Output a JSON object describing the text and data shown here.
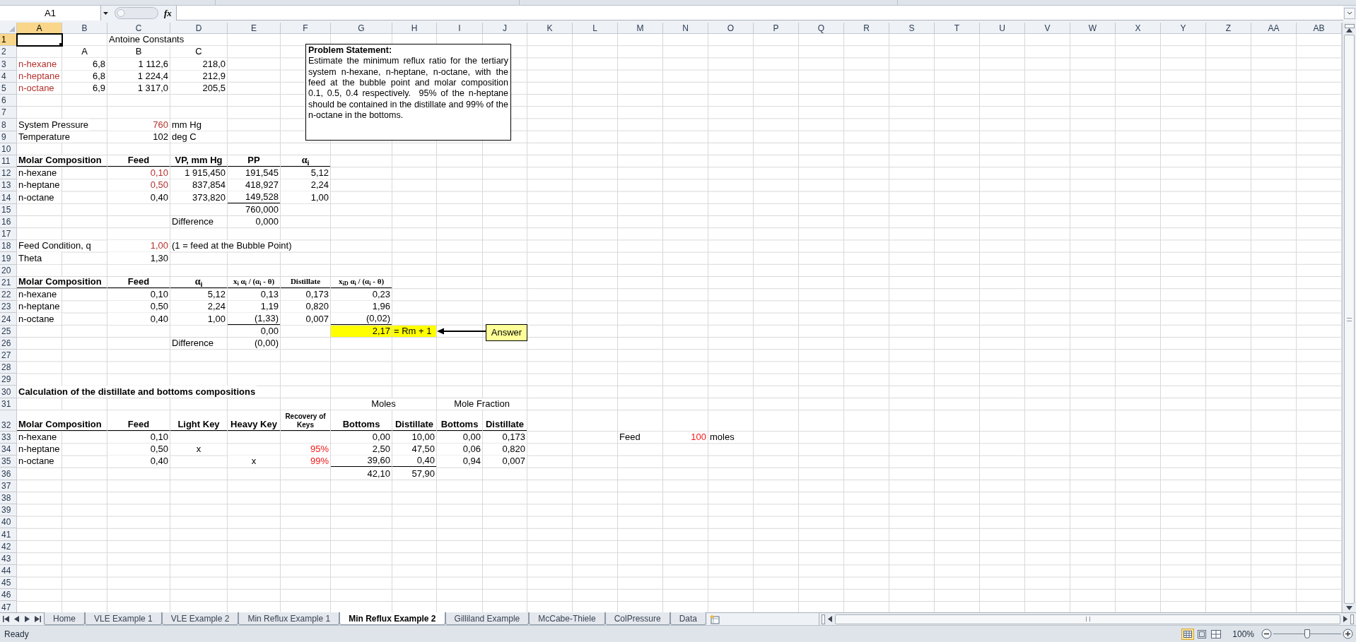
{
  "formula_bar": {
    "name_box": "A1",
    "function_button": "fx"
  },
  "columns": [
    {
      "label": "A",
      "selected": true
    },
    {
      "label": "B",
      "selected": false
    },
    {
      "label": "C",
      "selected": false
    },
    {
      "label": "D",
      "selected": false
    },
    {
      "label": "E",
      "selected": false
    },
    {
      "label": "F",
      "selected": false
    },
    {
      "label": "G",
      "selected": false
    },
    {
      "label": "H",
      "selected": false
    },
    {
      "label": "I",
      "selected": false
    },
    {
      "label": "J",
      "selected": false
    },
    {
      "label": "K",
      "selected": false
    },
    {
      "label": "L",
      "selected": false
    },
    {
      "label": "M",
      "selected": false
    },
    {
      "label": "N",
      "selected": false
    },
    {
      "label": "O",
      "selected": false
    },
    {
      "label": "P",
      "selected": false
    },
    {
      "label": "Q",
      "selected": false
    },
    {
      "label": "R",
      "selected": false
    },
    {
      "label": "S",
      "selected": false
    },
    {
      "label": "T",
      "selected": false
    },
    {
      "label": "U",
      "selected": false
    },
    {
      "label": "V",
      "selected": false
    },
    {
      "label": "W",
      "selected": false
    },
    {
      "label": "X",
      "selected": false
    },
    {
      "label": "Y",
      "selected": false
    },
    {
      "label": "Z",
      "selected": false
    },
    {
      "label": "AA",
      "selected": false
    },
    {
      "label": "AB",
      "selected": false
    }
  ],
  "rows": [
    {
      "label": "1",
      "selected": true,
      "cells": {
        "A": {
          "active": true
        },
        "C": {
          "text": "Antoine Constants",
          "kind": "label"
        }
      }
    },
    {
      "label": "2",
      "selected": false,
      "cells": {
        "B": {
          "text": "A",
          "kind": "center"
        },
        "C": {
          "text": "B",
          "kind": "center"
        },
        "D": {
          "text": "C",
          "kind": "center"
        }
      }
    },
    {
      "label": "3",
      "selected": false,
      "cells": {
        "A": {
          "text": "n-hexane",
          "kind": "label",
          "color": "#b3312d"
        },
        "B": {
          "text": "6,8",
          "kind": "number"
        },
        "C": {
          "text": "1 112,6",
          "kind": "number"
        },
        "D": {
          "text": "218,0",
          "kind": "number"
        }
      }
    },
    {
      "label": "4",
      "selected": false,
      "cells": {
        "A": {
          "text": "n-heptane",
          "kind": "label",
          "color": "#b3312d"
        },
        "B": {
          "text": "6,8",
          "kind": "number"
        },
        "C": {
          "text": "1 224,4",
          "kind": "number"
        },
        "D": {
          "text": "212,9",
          "kind": "number"
        }
      }
    },
    {
      "label": "5",
      "selected": false,
      "cells": {
        "A": {
          "text": "n-octane",
          "kind": "label",
          "color": "#b3312d"
        },
        "B": {
          "text": "6,9",
          "kind": "number"
        },
        "C": {
          "text": "1 317,0",
          "kind": "number"
        },
        "D": {
          "text": "205,5",
          "kind": "number"
        }
      }
    },
    {
      "label": "6",
      "selected": false
    },
    {
      "label": "7",
      "selected": false
    },
    {
      "label": "8",
      "selected": false,
      "cells": {
        "A": {
          "text": "System Pressure",
          "kind": "label"
        },
        "C": {
          "text": "760",
          "kind": "number",
          "color": "#b3312d"
        },
        "D": {
          "text": "mm Hg",
          "kind": "label"
        }
      }
    },
    {
      "label": "9",
      "selected": false,
      "cells": {
        "A": {
          "text": "Temperature",
          "kind": "label"
        },
        "C": {
          "text": "102",
          "kind": "number"
        },
        "D": {
          "text": "deg C",
          "kind": "label"
        }
      }
    },
    {
      "label": "10",
      "selected": false
    },
    {
      "label": "11",
      "selected": false,
      "cells": {
        "A": {
          "text": "Molar Composition",
          "kind": "heading",
          "underline": true
        },
        "B": {
          "underline": true
        },
        "C": {
          "text": "Feed",
          "kind": "column_heading",
          "underline": true
        },
        "D": {
          "text": "VP, mm Hg",
          "kind": "column_heading",
          "underline": true
        },
        "E": {
          "text": "PP",
          "kind": "column_heading",
          "underline": true
        },
        "F": {
          "text": "α$_{i}$",
          "kind": "greek_heading",
          "underline": true
        }
      }
    },
    {
      "label": "12",
      "selected": false,
      "cells": {
        "A": {
          "text": "n-hexane",
          "kind": "label"
        },
        "C": {
          "text": "0,10",
          "kind": "number",
          "color": "#b3312d"
        },
        "D": {
          "text": "1 915,450",
          "kind": "number"
        },
        "E": {
          "text": "191,545",
          "kind": "number"
        },
        "F": {
          "text": "5,12",
          "kind": "number"
        }
      }
    },
    {
      "label": "13",
      "selected": false,
      "cells": {
        "A": {
          "text": "n-heptane",
          "kind": "label"
        },
        "C": {
          "text": "0,50",
          "kind": "number",
          "color": "#b3312d"
        },
        "D": {
          "text": "837,854",
          "kind": "number"
        },
        "E": {
          "text": "418,927",
          "kind": "number"
        },
        "F": {
          "text": "2,24",
          "kind": "number"
        }
      }
    },
    {
      "label": "14",
      "selected": false,
      "cells": {
        "A": {
          "text": "n-octane",
          "kind": "label"
        },
        "C": {
          "text": "0,40",
          "kind": "number"
        },
        "D": {
          "text": "373,820",
          "kind": "number"
        },
        "E": {
          "text": "149,528",
          "kind": "number",
          "underline": true
        },
        "F": {
          "text": "1,00",
          "kind": "number"
        }
      }
    },
    {
      "label": "15",
      "selected": false,
      "cells": {
        "E": {
          "text": "760,000",
          "kind": "number"
        }
      }
    },
    {
      "label": "16",
      "selected": false,
      "cells": {
        "D": {
          "text": "Difference",
          "kind": "label"
        },
        "E": {
          "text": "0,000",
          "kind": "number"
        }
      }
    },
    {
      "label": "17",
      "selected": false
    },
    {
      "label": "18",
      "selected": false,
      "cells": {
        "A": {
          "text": "Feed Condition, q",
          "kind": "label"
        },
        "C": {
          "text": "1,00",
          "kind": "number",
          "color": "#b3312d"
        },
        "D": {
          "text": "(1 = feed at the Bubble Point)",
          "kind": "label"
        }
      }
    },
    {
      "label": "19",
      "selected": false,
      "cells": {
        "A": {
          "text": "Theta",
          "kind": "label"
        },
        "C": {
          "text": "1,30",
          "kind": "number"
        }
      }
    },
    {
      "label": "20",
      "selected": false
    },
    {
      "label": "21",
      "selected": false,
      "cells": {
        "A": {
          "text": "Molar Composition",
          "kind": "heading",
          "underline": true
        },
        "B": {
          "underline": true
        },
        "C": {
          "text": "Feed",
          "kind": "column_heading",
          "underline": true
        },
        "D": {
          "text": "α$_{i}$",
          "kind": "greek_heading",
          "underline": true
        },
        "E": {
          "text": "x$_{i}$ α$_{i}$ / (α$_{i}$ - θ)",
          "kind": "formula_heading",
          "underline": true
        },
        "F": {
          "text": "Distillate",
          "kind": "formula_heading",
          "underline": true
        },
        "G": {
          "text": "x$_{iD}$ α$_{i}$ / (α$_{i}$ - θ)",
          "kind": "formula_heading",
          "underline": true
        }
      }
    },
    {
      "label": "22",
      "selected": false,
      "cells": {
        "A": {
          "text": "n-hexane",
          "kind": "label"
        },
        "C": {
          "text": "0,10",
          "kind": "number"
        },
        "D": {
          "text": "5,12",
          "kind": "number"
        },
        "E": {
          "text": "0,13",
          "kind": "number"
        },
        "F": {
          "text": "0,173",
          "kind": "number"
        },
        "G": {
          "text": "0,23",
          "kind": "number"
        }
      }
    },
    {
      "label": "23",
      "selected": false,
      "cells": {
        "A": {
          "text": "n-heptane",
          "kind": "label"
        },
        "C": {
          "text": "0,50",
          "kind": "number"
        },
        "D": {
          "text": "2,24",
          "kind": "number"
        },
        "E": {
          "text": "1,19",
          "kind": "number"
        },
        "F": {
          "text": "0,820",
          "kind": "number"
        },
        "G": {
          "text": "1,96",
          "kind": "number"
        }
      }
    },
    {
      "label": "24",
      "selected": false,
      "cells": {
        "A": {
          "text": "n-octane",
          "kind": "label"
        },
        "C": {
          "text": "0,40",
          "kind": "number"
        },
        "D": {
          "text": "1,00",
          "kind": "number"
        },
        "E": {
          "text": "(1,33)",
          "kind": "number",
          "underline": true
        },
        "F": {
          "text": "0,007",
          "kind": "number"
        },
        "G": {
          "text": "(0,02)",
          "kind": "number",
          "underline": true
        }
      }
    },
    {
      "label": "25",
      "selected": false,
      "cells": {
        "E": {
          "text": "0,00",
          "kind": "number"
        },
        "G": {
          "text": "2,17",
          "kind": "number",
          "highlight": true
        },
        "H": {
          "text": "= Rm + 1",
          "kind": "label",
          "highlight": true
        }
      }
    },
    {
      "label": "26",
      "selected": false,
      "cells": {
        "D": {
          "text": "Difference",
          "kind": "label"
        },
        "E": {
          "text": "(0,00)",
          "kind": "number"
        }
      }
    },
    {
      "label": "27",
      "selected": false
    },
    {
      "label": "28",
      "selected": false
    },
    {
      "label": "29",
      "selected": false
    },
    {
      "label": "30",
      "selected": false,
      "cells": {
        "A": {
          "text": "Calculation of the distillate and bottoms compositions",
          "kind": "heading"
        }
      }
    },
    {
      "label": "31",
      "selected": false,
      "cells": {
        "G": {
          "text": "Moles",
          "kind": "merged"
        },
        "I": {
          "text": "Mole Fraction",
          "kind": "merged"
        }
      }
    },
    {
      "label": "32",
      "selected": false,
      "cells": {
        "A": {
          "text": "Molar Composition",
          "kind": "heading",
          "underline": true
        },
        "B": {
          "underline": true
        },
        "C": {
          "text": "Feed",
          "kind": "column_heading",
          "underline": true
        },
        "D": {
          "text": "Light Key",
          "kind": "column_heading",
          "underline": true
        },
        "E": {
          "text": "Heavy Key",
          "kind": "column_heading",
          "underline": true
        },
        "F": {
          "text": "Recovery of Keys",
          "kind": "small_heading",
          "underline": true
        },
        "G": {
          "text": "Bottoms",
          "kind": "column_heading",
          "underline": true
        },
        "H": {
          "text": "Distillate",
          "kind": "column_heading",
          "underline": true
        },
        "I": {
          "text": "Bottoms",
          "kind": "column_heading",
          "underline": true
        },
        "J": {
          "text": "Distillate",
          "kind": "column_heading",
          "underline": true
        }
      }
    },
    {
      "label": "33",
      "selected": false,
      "cells": {
        "A": {
          "text": "n-hexane",
          "kind": "label"
        },
        "C": {
          "text": "0,10",
          "kind": "number"
        },
        "G": {
          "text": "0,00",
          "kind": "number"
        },
        "H": {
          "text": "10,00",
          "kind": "number"
        },
        "I": {
          "text": "0,00",
          "kind": "number"
        },
        "J": {
          "text": "0,173",
          "kind": "number"
        },
        "M": {
          "text": "Feed",
          "kind": "label"
        },
        "N": {
          "text": "100",
          "kind": "number",
          "color": "#f01818"
        },
        "O": {
          "text": "moles",
          "kind": "label"
        }
      }
    },
    {
      "label": "34",
      "selected": false,
      "cells": {
        "A": {
          "text": "n-heptane",
          "kind": "label"
        },
        "C": {
          "text": "0,50",
          "kind": "number"
        },
        "D": {
          "text": "x",
          "kind": "center"
        },
        "F": {
          "text": "95%",
          "kind": "number",
          "color": "#f01818"
        },
        "G": {
          "text": "2,50",
          "kind": "number"
        },
        "H": {
          "text": "47,50",
          "kind": "number"
        },
        "I": {
          "text": "0,06",
          "kind": "number"
        },
        "J": {
          "text": "0,820",
          "kind": "number"
        }
      }
    },
    {
      "label": "35",
      "selected": false,
      "cells": {
        "A": {
          "text": "n-octane",
          "kind": "label"
        },
        "C": {
          "text": "0,40",
          "kind": "number"
        },
        "E": {
          "text": "x",
          "kind": "center"
        },
        "F": {
          "text": "99%",
          "kind": "number",
          "color": "#f01818"
        },
        "G": {
          "text": "39,60",
          "kind": "number",
          "underline": true
        },
        "H": {
          "text": "0,40",
          "kind": "number",
          "underline": true
        },
        "I": {
          "text": "0,94",
          "kind": "number"
        },
        "J": {
          "text": "0,007",
          "kind": "number"
        }
      }
    },
    {
      "label": "36",
      "selected": false,
      "cells": {
        "G": {
          "text": "42,10",
          "kind": "number"
        },
        "H": {
          "text": "57,90",
          "kind": "number"
        }
      }
    },
    {
      "label": "37",
      "selected": false
    },
    {
      "label": "38",
      "selected": false
    },
    {
      "label": "39",
      "selected": false
    },
    {
      "label": "40",
      "selected": false
    },
    {
      "label": "41",
      "selected": false
    },
    {
      "label": "42",
      "selected": false
    },
    {
      "label": "43",
      "selected": false
    },
    {
      "label": "44",
      "selected": false
    },
    {
      "label": "45",
      "selected": false
    },
    {
      "label": "46",
      "selected": false
    },
    {
      "label": "47",
      "selected": false
    }
  ],
  "text_box": {
    "title": "Problem Statement:",
    "body": "Estimate the minimum reflux ratio for the tertiary system n-hexane, n-heptane, n-octane, with the feed at the bubble point and molar composition 0.1, 0.5, 0.4 respectively.  95% of the n-heptane should be contained in the distillate and 99% of the n-octane in the bottoms."
  },
  "callout": {
    "text": "Answer"
  },
  "sheet_tabs": [
    {
      "label": "Home",
      "selected": false
    },
    {
      "label": "VLE Example 1",
      "selected": false
    },
    {
      "label": "VLE Example 2",
      "selected": false
    },
    {
      "label": "Min Reflux Example 1",
      "selected": false
    },
    {
      "label": "Min Reflux Example 2",
      "selected": true
    },
    {
      "label": "Gilliland Example",
      "selected": false
    },
    {
      "label": "McCabe-Thiele",
      "selected": false
    },
    {
      "label": "ColPressure",
      "selected": false
    },
    {
      "label": "Data",
      "selected": false
    }
  ],
  "status_bar": {
    "status": "Ready",
    "zoom": "100%",
    "level": 0.5
  }
}
